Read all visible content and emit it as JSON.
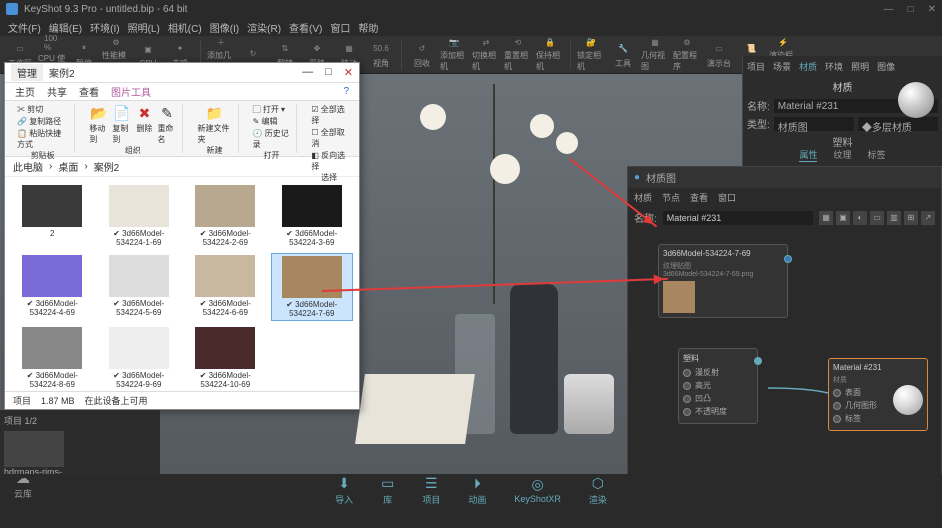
{
  "app": {
    "title": "KeyShot 9.3 Pro",
    "document": "untitled.bip",
    "bits": "64 bit"
  },
  "win_buttons": {
    "min": "—",
    "max": "□",
    "close": "✕"
  },
  "menu": [
    "文件(F)",
    "编辑(E)",
    "环境(I)",
    "照明(L)",
    "相机(C)",
    "图像(I)",
    "渲染(R)",
    "查看(V)",
    "窗口",
    "帮助"
  ],
  "toolbar": [
    {
      "label": "工作区",
      "icon": "▭"
    },
    {
      "label": "CPU 使用量",
      "icon": "100 %"
    },
    {
      "label": "暂停",
      "icon": "⏸"
    },
    {
      "label": "性能模式",
      "icon": "⚙"
    },
    {
      "label": "CPU",
      "icon": "▣"
    },
    {
      "label": "去噪",
      "icon": "✦"
    },
    {
      "label": "添加几何",
      "icon": "＋"
    },
    {
      "label": "",
      "icon": "↻"
    },
    {
      "label": "翻转",
      "icon": "⇅"
    },
    {
      "label": "平移",
      "icon": "✥"
    },
    {
      "label": "移动",
      "icon": "▦"
    },
    {
      "label": "视角",
      "icon": "50.6"
    },
    {
      "label": "回收",
      "icon": "↺"
    },
    {
      "label": "添加相机",
      "icon": "📷"
    },
    {
      "label": "切换相机",
      "icon": "⇄"
    },
    {
      "label": "重置相机",
      "icon": "⟲"
    },
    {
      "label": "保持相机",
      "icon": "🔒"
    },
    {
      "label": "锁定相机",
      "icon": "🔐"
    },
    {
      "label": "工具",
      "icon": "🔧"
    },
    {
      "label": "几何视图",
      "icon": "▦"
    },
    {
      "label": "配置程序",
      "icon": "⚙"
    },
    {
      "label": "演示台",
      "icon": "▭"
    },
    {
      "label": "脚本",
      "icon": "📜"
    },
    {
      "label": "渲染程序",
      "icon": "⚡"
    }
  ],
  "right_panel": {
    "tabs": [
      "项目",
      "场景",
      "材质",
      "环境",
      "照明",
      "图像"
    ],
    "title": "材质",
    "name_label": "名称:",
    "name_value": "Material #231",
    "type_label": "类型:",
    "type_btn": "材质图",
    "multi_btn": "◆多层材质",
    "sub": "塑料",
    "subtabs": [
      "属性",
      "纹理",
      "标签"
    ]
  },
  "node_panel": {
    "window_title": "材质图",
    "menu": [
      "材质",
      "节点",
      "查看",
      "窗口"
    ],
    "name_label": "名称:",
    "name_value": "Material #231",
    "tex_node": {
      "title": "3d66Model-534224-7-69",
      "sub": "纹理贴图",
      "file": "3d66Model-534224-7-69.png"
    },
    "plastic_node": {
      "title": "塑料",
      "ports": [
        "漫反射",
        "高光",
        "凹凸",
        "不透明度"
      ]
    },
    "mat_node": {
      "title": "Material #231",
      "sub": "材质",
      "ports": [
        "表面",
        "几何图形",
        "标签"
      ]
    }
  },
  "explorer": {
    "tabs": [
      "管理",
      "案例2"
    ],
    "nav": [
      "主页",
      "共享",
      "查看",
      "图片工具"
    ],
    "ribbon": {
      "clip": {
        "cut": "剪切",
        "copy": "复制路径",
        "paste": "粘贴快捷方式",
        "group": "剪贴板"
      },
      "org": {
        "move": "移动到",
        "copyto": "复制到",
        "del": "删除",
        "rename": "重命名",
        "newf": "新建文件夹",
        "group": "组织",
        "new": "新建"
      },
      "open": {
        "open": "打开",
        "edit": "编辑",
        "hist": "历史记录",
        "group": "打开"
      },
      "sel": {
        "all": "全部选择",
        "none": "全部取消",
        "inv": "反向选择",
        "group": "选择"
      }
    },
    "breadcrumb": [
      "此电脑",
      "桌面",
      "案例2"
    ],
    "files": [
      {
        "name": "2",
        "type": "folder"
      },
      {
        "name": "3d66Model-534224-1-69"
      },
      {
        "name": "3d66Model-534224-2-69"
      },
      {
        "name": "3d66Model-534224-3-69"
      },
      {
        "name": "3d66Model-534224-4-69"
      },
      {
        "name": "3d66Model-534224-5-69"
      },
      {
        "name": "3d66Model-534224-6-69"
      },
      {
        "name": "3d66Model-534224-7-69",
        "sel": true
      },
      {
        "name": "3d66Model-534224-8-69"
      },
      {
        "name": "3d66Model-534224-9-69"
      },
      {
        "name": "3d66Model-534224-10-69"
      }
    ],
    "status": {
      "count": "项目",
      "size": "1.87 MB",
      "avail": "在此设备上可用"
    }
  },
  "left": {
    "hdr": "项目 1/2",
    "file": "hdrmaps-rims-"
  },
  "bottom": {
    "cloud": "云库",
    "items": [
      "导入",
      "库",
      "项目",
      "动画",
      "KeyShotXR",
      "渲染"
    ]
  }
}
